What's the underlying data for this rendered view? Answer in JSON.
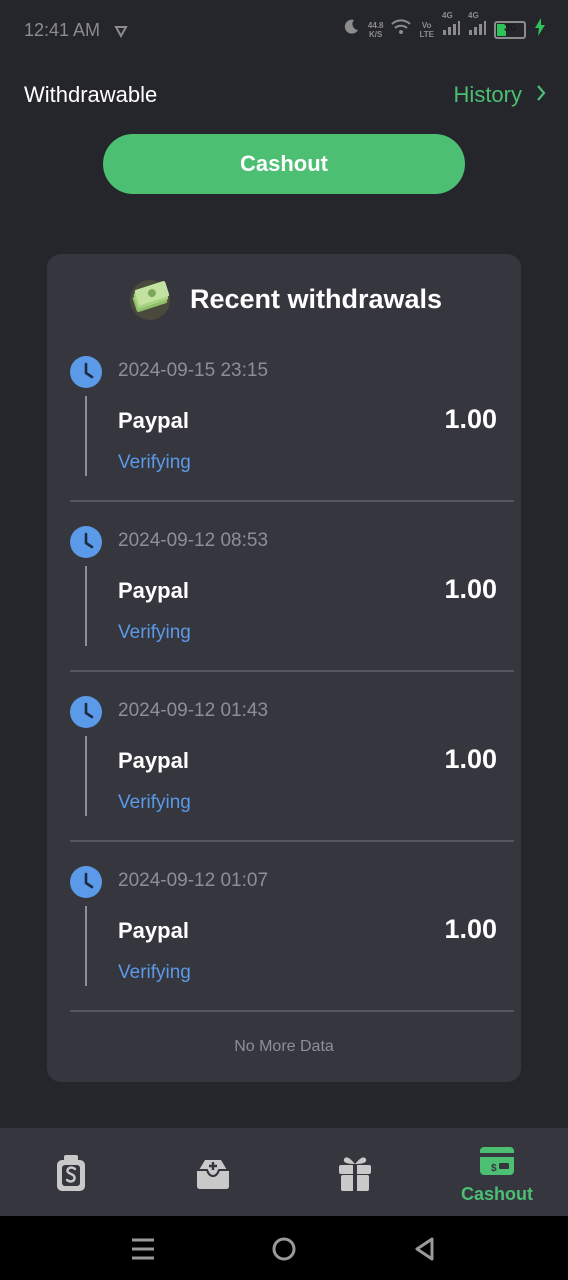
{
  "status_bar": {
    "time": "12:41 AM",
    "net_speed_top": "44.8",
    "net_speed_bottom": "K/S",
    "volte_top": "Vo",
    "volte_bottom": "LTE",
    "sig1": "4G",
    "sig2": "4G",
    "battery": "30"
  },
  "header": {
    "title": "Withdrawable",
    "history_label": "History"
  },
  "cashout_button": "Cashout",
  "card": {
    "title": "Recent withdrawals",
    "entries": [
      {
        "time": "2024-09-15 23:15",
        "method": "Paypal",
        "amount": "1.00",
        "status": "Verifying"
      },
      {
        "time": "2024-09-12 08:53",
        "method": "Paypal",
        "amount": "1.00",
        "status": "Verifying"
      },
      {
        "time": "2024-09-12 01:43",
        "method": "Paypal",
        "amount": "1.00",
        "status": "Verifying"
      },
      {
        "time": "2024-09-12 01:07",
        "method": "Paypal",
        "amount": "1.00",
        "status": "Verifying"
      }
    ],
    "footer": "No More Data"
  },
  "tab_bar": {
    "tabs": [
      {
        "icon": "wallet-dollar-icon",
        "label": ""
      },
      {
        "icon": "inbox-add-icon",
        "label": ""
      },
      {
        "icon": "gift-icon",
        "label": ""
      },
      {
        "icon": "cash-card-icon",
        "label": "Cashout",
        "active": true
      }
    ]
  },
  "colors": {
    "accent": "#4cbf73",
    "background": "#25262b",
    "card": "#35363e",
    "status_blue": "#5b9ae8"
  }
}
